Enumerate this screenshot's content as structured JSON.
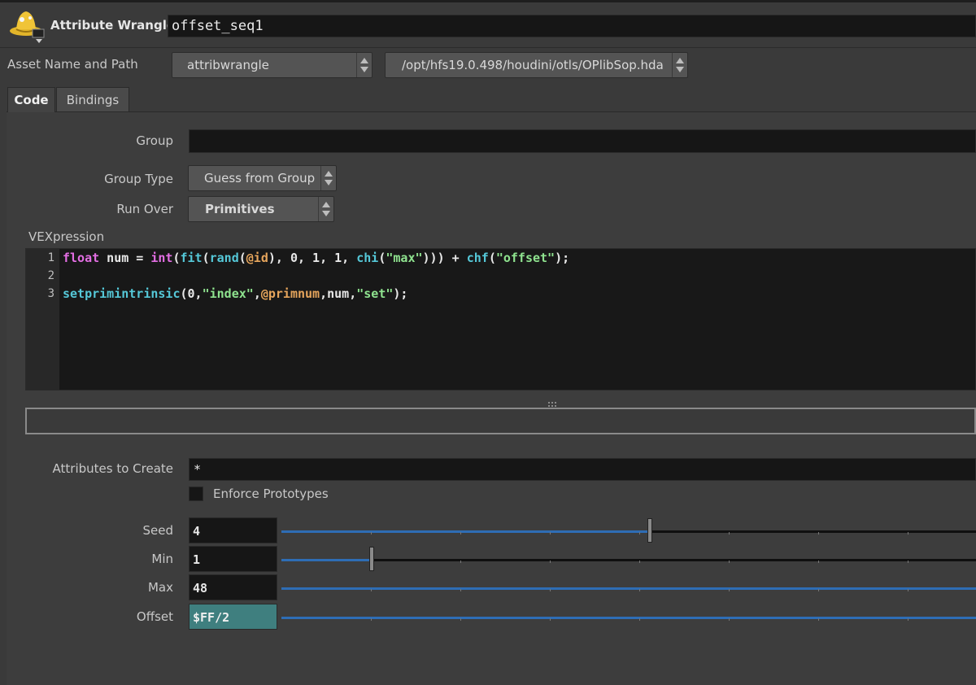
{
  "header": {
    "node_type": "Attribute Wrangle",
    "node_name": "offset_seq1",
    "icon": "wrangle-cowboy-hat-icon"
  },
  "asset": {
    "label": "Asset Name and Path",
    "name": "attribwrangle",
    "path": "/opt/hfs19.0.498/houdini/otls/OPlibSop.hda"
  },
  "tabs": [
    {
      "label": "Code",
      "active": true
    },
    {
      "label": "Bindings",
      "active": false
    }
  ],
  "params": {
    "group_label": "Group",
    "group_value": "",
    "group_type_label": "Group Type",
    "group_type_value": "Guess from Group",
    "run_over_label": "Run Over",
    "run_over_value": "Primitives",
    "vex_label": "VEXpression",
    "attributes_label": "Attributes to Create",
    "attributes_value": "*",
    "enforce_label": "Enforce Prototypes",
    "enforce_checked": false
  },
  "code": {
    "line_numbers": [
      "1",
      "2",
      "3"
    ],
    "line1": [
      {
        "t": "float",
        "c": "kw"
      },
      {
        "t": " num = ",
        "c": "pl"
      },
      {
        "t": "int",
        "c": "kw"
      },
      {
        "t": "(",
        "c": "pl"
      },
      {
        "t": "fit",
        "c": "fn"
      },
      {
        "t": "(",
        "c": "pl"
      },
      {
        "t": "rand",
        "c": "fn"
      },
      {
        "t": "(",
        "c": "pl"
      },
      {
        "t": "@id",
        "c": "attr"
      },
      {
        "t": "), 0, 1, 1, ",
        "c": "pl"
      },
      {
        "t": "chi",
        "c": "fn"
      },
      {
        "t": "(",
        "c": "pl"
      },
      {
        "t": "\"max\"",
        "c": "str"
      },
      {
        "t": "))) + ",
        "c": "pl"
      },
      {
        "t": "chf",
        "c": "fn"
      },
      {
        "t": "(",
        "c": "pl"
      },
      {
        "t": "\"offset\"",
        "c": "str"
      },
      {
        "t": ");",
        "c": "pl"
      }
    ],
    "line3": [
      {
        "t": "setprimintrinsic",
        "c": "fn"
      },
      {
        "t": "(0,",
        "c": "pl"
      },
      {
        "t": "\"index\"",
        "c": "str"
      },
      {
        "t": ",",
        "c": "pl"
      },
      {
        "t": "@primnum",
        "c": "attr"
      },
      {
        "t": ",num,",
        "c": "pl"
      },
      {
        "t": "\"set\"",
        "c": "str"
      },
      {
        "t": ");",
        "c": "pl"
      }
    ]
  },
  "sliders": [
    {
      "label": "Seed",
      "value": "4",
      "fraction": 0.53,
      "handle": true,
      "expression": false
    },
    {
      "label": "Min",
      "value": "1",
      "fraction": 0.13,
      "handle": true,
      "expression": false
    },
    {
      "label": "Max",
      "value": "48",
      "fraction": 1.0,
      "handle": false,
      "expression": false
    },
    {
      "label": "Offset",
      "value": "$FF/2",
      "fraction": 1.0,
      "handle": false,
      "expression": true
    }
  ],
  "colors": {
    "expression_field": "#3f7f7f",
    "slider_fill": "#2e6db5"
  }
}
